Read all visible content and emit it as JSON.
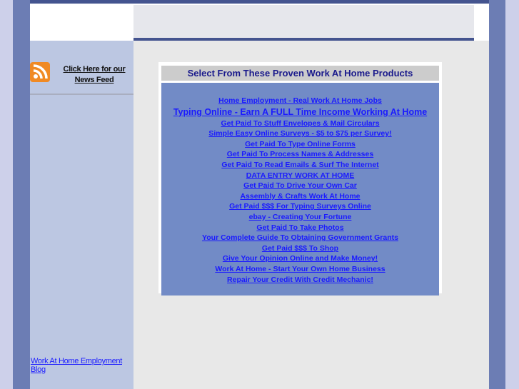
{
  "sidebar": {
    "feed_label": "Click Here for our News Feed",
    "blog_link": "Work At Home Employment Blog"
  },
  "products": {
    "title": "Select From These Proven Work At Home Products",
    "links": [
      "Home Employment - Real Work At Home Jobs",
      "Typing Online - Earn A FULL Time Income Working At Home",
      "Get Paid To Stuff Envelopes & Mail Circulars",
      "Simple Easy Online Surveys - $5 to $75 per Survey!",
      "Get Paid To Type Online Forms",
      "Get Paid To Process Names & Addresses",
      "Get Paid To Read Emails & Surf The Internet",
      "DATA ENTRY WORK AT HOME",
      "Get Paid To Drive Your Own Car",
      "Assembly & Crafts Work At Home",
      "Get Paid $$$ For Typing Surveys Online",
      "ebay - Creating Your Fortune",
      "Get Paid To Take Photos",
      "Your Complete Guide To Obtaining Government Grants",
      "Get Paid $$$ To Shop",
      "Give Your Opinion Online and Make Money!",
      "Work At Home - Start Your Own Home Business",
      "Repair Your Credit With Credit Mechanic!"
    ]
  }
}
